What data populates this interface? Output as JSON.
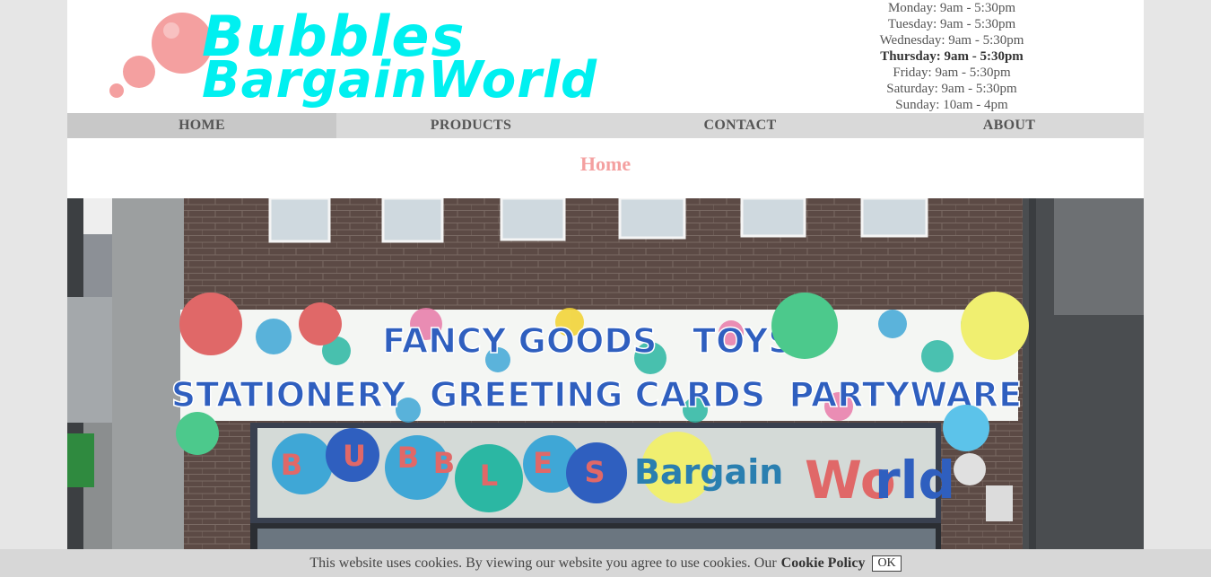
{
  "brand": {
    "line1": "Bubbles",
    "line2": "BargainWorld",
    "logo_color": "#00f0f0",
    "bubble_color": "#f4a0a0"
  },
  "opening_hours": [
    {
      "text": "Monday: 9am - 5:30pm",
      "today": false
    },
    {
      "text": "Tuesday: 9am - 5:30pm",
      "today": false
    },
    {
      "text": "Wednesday: 9am - 5:30pm",
      "today": false
    },
    {
      "text": "Thursday: 9am - 5:30pm",
      "today": true
    },
    {
      "text": "Friday: 9am - 5:30pm",
      "today": false
    },
    {
      "text": "Saturday: 9am - 5:30pm",
      "today": false
    },
    {
      "text": "Sunday: 10am - 4pm",
      "today": false
    }
  ],
  "nav": {
    "items": [
      {
        "label": "HOME",
        "active": true
      },
      {
        "label": "PRODUCTS",
        "active": false
      },
      {
        "label": "CONTACT",
        "active": false
      },
      {
        "label": "ABOUT",
        "active": false
      }
    ]
  },
  "main": {
    "title": "Home",
    "photo": {
      "sign_line1": "FANCY GOODS   TOYS",
      "sign_line2": "STATIONERY  GREETING CARDS  PARTYWARE",
      "fascia_letters": [
        "B",
        "U",
        "B",
        "B",
        "L",
        "E",
        "S"
      ],
      "fascia_word1": "Bargain",
      "fascia_word2_a": "Wo",
      "fascia_word2_b": "rld"
    }
  },
  "cookie": {
    "message": "This website uses cookies. By viewing our website you agree to use cookies. Our",
    "policy_link": "Cookie Policy",
    "ok_label": "OK"
  },
  "colors": {
    "page_bg": "#e6e6e6",
    "nav_bg": "#d9d9d9",
    "title": "#f4a0a0",
    "sign_text": "#2f5fbf"
  }
}
